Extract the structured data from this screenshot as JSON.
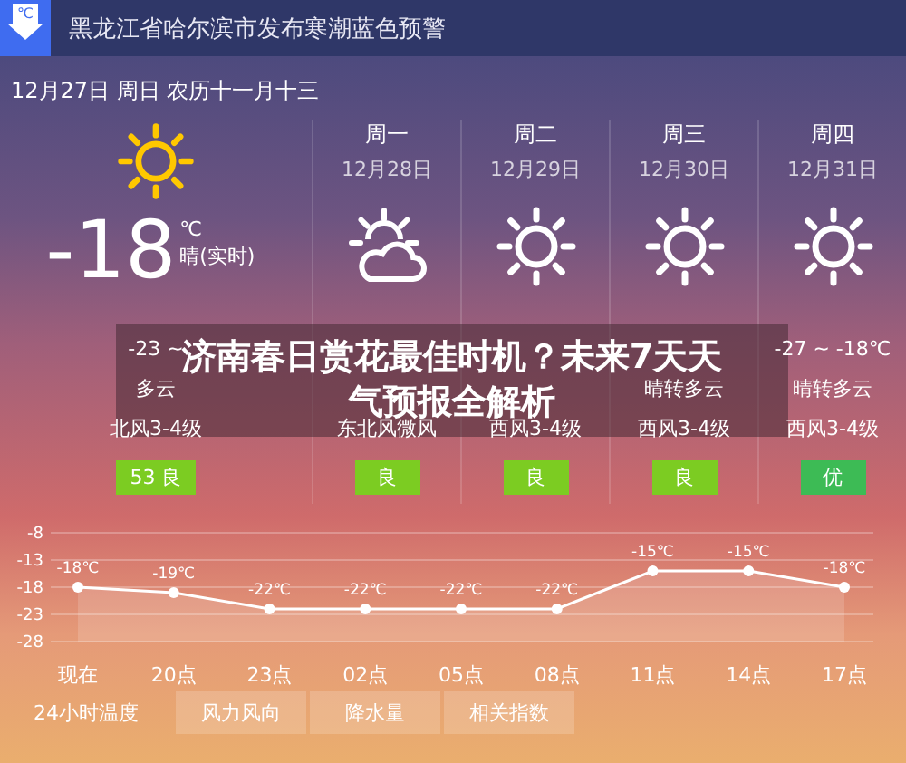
{
  "alert": {
    "icon_text": "℃",
    "title": "黑龙江省哈尔滨市发布寒潮蓝色预警"
  },
  "date_line": "12月27日 周日 农历十一月十三",
  "current": {
    "kind": "sun",
    "temp": "-18",
    "unit": "℃",
    "desc": "晴(实时)",
    "range": "-23 ~",
    "condition": "多云",
    "wind": "北风3-4级",
    "aqi": "53 良",
    "color": "#7ccc22"
  },
  "forecast": [
    {
      "day": "周一",
      "date": "12月28日",
      "kind": "cloud-sun",
      "wind": "东北风微风",
      "aqi": "良",
      "color": "#7ccc22"
    },
    {
      "day": "周二",
      "date": "12月29日",
      "kind": "sun",
      "wind": "西风3-4级",
      "aqi": "良",
      "color": "#7ccc22"
    },
    {
      "day": "周三",
      "date": "12月30日",
      "kind": "sun",
      "condition": "晴转多云",
      "wind": "西风3-4级",
      "aqi": "良",
      "color": "#7ccc22"
    },
    {
      "day": "周四",
      "date": "12月31日",
      "kind": "sun",
      "range": "-27 ~ -18℃",
      "condition": "晴转多云",
      "wind": "西风3-4级",
      "aqi": "优",
      "color": "#3dbb55"
    }
  ],
  "banner": {
    "lines": [
      "济南春日赏花最佳时机？未来7天天",
      "气预报全解析"
    ]
  },
  "chart": {
    "chart_data": {
      "type": "area",
      "categories": [
        "现在",
        "20点",
        "23点",
        "02点",
        "05点",
        "08点",
        "11点",
        "14点",
        "17点"
      ],
      "series": [
        {
          "color": "#ffffff",
          "values": [
            -18,
            -19,
            -22,
            -22,
            -22,
            -22,
            -15,
            -15,
            -18
          ]
        }
      ],
      "grid": true,
      "value_labels": [
        "-18℃",
        "-19℃",
        "-22℃",
        "-22℃",
        "-22℃",
        "-22℃",
        "-15℃",
        "-15℃",
        "-18℃"
      ],
      "ylim": [
        -28,
        -8
      ],
      "yticks": [
        -8,
        -13,
        -18,
        -23,
        -28
      ]
    }
  },
  "tabs": [
    {
      "label": "24小时温度",
      "selected": true
    },
    {
      "label": "风力风向",
      "selected": false
    },
    {
      "label": "降水量",
      "selected": false
    },
    {
      "label": "相关指数",
      "selected": false
    }
  ]
}
